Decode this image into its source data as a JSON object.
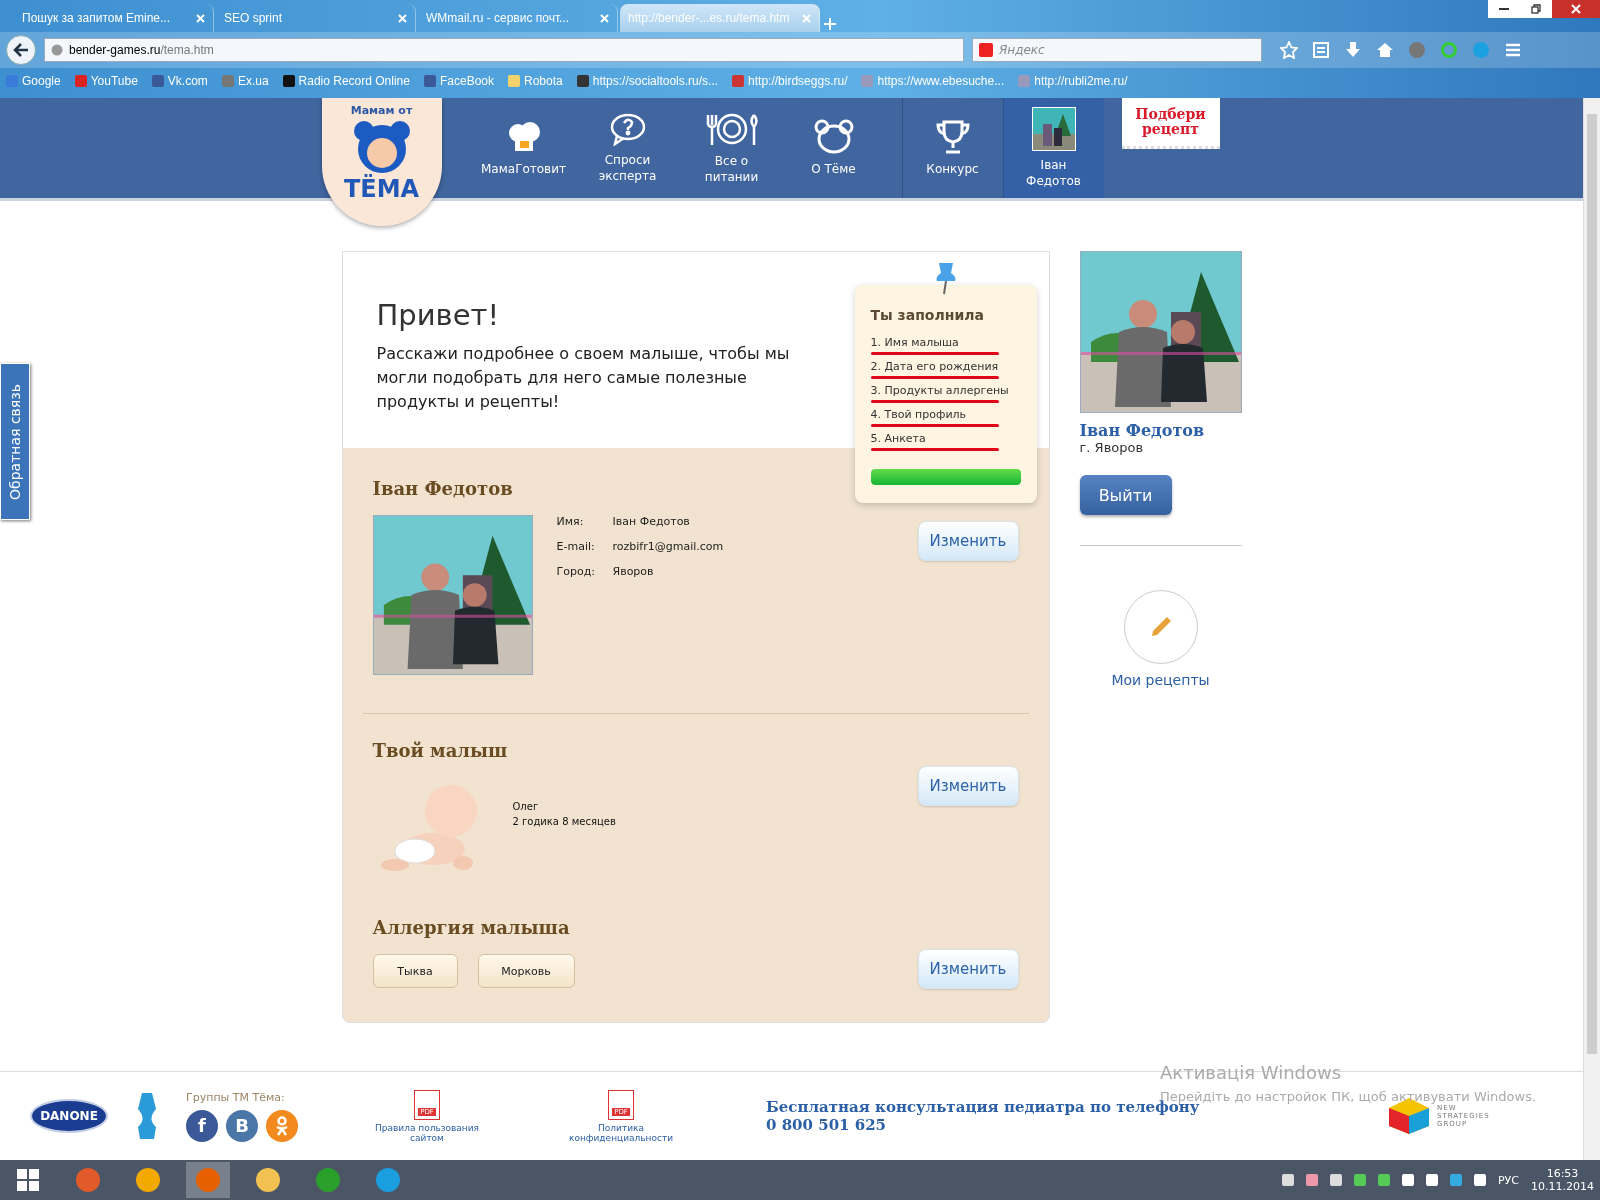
{
  "browser": {
    "tabs": [
      {
        "title": "Пошук за запитом Emine...",
        "selected": false
      },
      {
        "title": "SEO sprint",
        "selected": false
      },
      {
        "title": "WMmail.ru - сервис почт...",
        "selected": false
      },
      {
        "title": "http://bender-...es.ru/tema.htm",
        "selected": true
      }
    ],
    "url": {
      "host": "bender-games.ru",
      "path": "/tema.htm"
    },
    "search": {
      "placeholder": "Яндекс"
    },
    "bookmarks": [
      "Google",
      "YouTube",
      "Vk.com",
      "Ex.ua",
      "Radio Record Online",
      "FaceBook",
      "Robota",
      "https://socialtools.ru/s...",
      "http://birdseggs.ru/",
      "https://www.ebesuche...",
      "http://rubli2me.ru/"
    ]
  },
  "site": {
    "logo": {
      "top": "Мамам от",
      "name": "ТЁМА"
    },
    "nav": [
      {
        "label": "МамаГотовит",
        "selected": false
      },
      {
        "label": "Спроси эксперта",
        "selected": false
      },
      {
        "label": "Все о питании",
        "selected": false
      },
      {
        "label": "О Тёме",
        "selected": false
      },
      {
        "label": "Конкурс",
        "selected": false
      },
      {
        "label": "Іван Федотов",
        "selected": true
      }
    ],
    "promo": "Подбери рецепт",
    "feedback": "Обратная связь"
  },
  "greeting": {
    "title": "Привет!",
    "text": "Расскажи подробнее о своем малыше, чтобы мы могли подобрать для него самые полезные продукты и рецепты!"
  },
  "checklist": {
    "title": "Ты заполнила",
    "items": [
      {
        "label": "1. Имя малыша",
        "done": true
      },
      {
        "label": "2. Дата его рождения",
        "done": true
      },
      {
        "label": "3. Продукты аллергены",
        "done": true
      },
      {
        "label": "4. Твой профиль",
        "done": true
      },
      {
        "label": "5. Анкета",
        "done": true
      }
    ],
    "level": 1
  },
  "profile": {
    "heading": "Іван Федотов",
    "fields": [
      {
        "label": "Имя:",
        "value": "Іван Федотов"
      },
      {
        "label": "E-mail:",
        "value": "rozbifr1@gmail.com"
      },
      {
        "label": "Город:",
        "value": "Яворов"
      }
    ],
    "button": "Изменить"
  },
  "baby": {
    "heading": "Твой малыш",
    "name": "Олег",
    "age": "2 годика 8 месяцев",
    "button": "Изменить"
  },
  "allergy": {
    "heading": "Аллергия малыша",
    "tags": [
      "Тыква",
      "Морковь"
    ],
    "button": "Изменить"
  },
  "sidebar": {
    "name": "Іван Федотов",
    "city": "г. Яворов",
    "logout": "Выйти",
    "recipes": "Мои рецепты"
  },
  "footer": {
    "brand": "DANONE",
    "groups_label": "Группы ТМ Тёма:",
    "social": [
      "f",
      "В"
    ],
    "docs": [
      {
        "icon_label": "PDF",
        "title": "Правила пользования сайтом"
      },
      {
        "icon_label": "PDF",
        "title": "Политика конфиденциальности"
      }
    ],
    "phone": {
      "title": "Бесплатная консультация педиатра по телефону",
      "number": "0 800 501 625"
    },
    "partner": "NEW STRATEGIES GROUP"
  },
  "windows_notice": {
    "title": "Активація Windows",
    "text": "Перейдіть до настройок ПК, щоб активувати Windows."
  },
  "taskbar": {
    "lang": "РУС",
    "time": "16:53",
    "date": "10.11.2014"
  }
}
